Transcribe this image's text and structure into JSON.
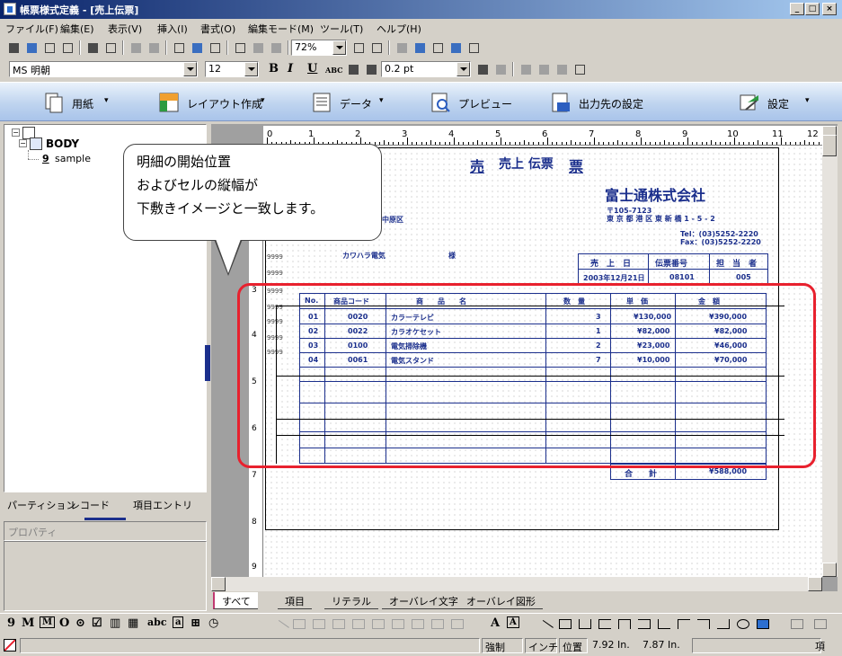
{
  "window": {
    "title": "帳票様式定義 - [売上伝票]",
    "buttons": [
      "_",
      "□",
      "×"
    ]
  },
  "menu": [
    "ファイル(F)",
    "編集(E)",
    "表示(V)",
    "挿入(I)",
    "書式(O)",
    "編集モード(M)",
    "ツール(T)",
    "ヘルプ(H)"
  ],
  "toolbar": {
    "zoom": "72%",
    "font_name": "MS 明朝",
    "font_size": "12",
    "bold": "B",
    "italic": "I",
    "underline": "U",
    "abc": "ABC",
    "line_width": "0.2 pt"
  },
  "ribbon": {
    "paper": "用紙",
    "layout": "レイアウト作成",
    "data": "データ",
    "preview": "プレビュー",
    "output": "出力先の設定",
    "settings": "設定"
  },
  "tree": {
    "root": "BODY",
    "child_num": "9",
    "child_label": "sample"
  },
  "left_tabs": {
    "partition": "パーティション",
    "record": "レコード",
    "item_entry": "項目エントリ"
  },
  "properties_label": "プロパティ",
  "sheet_tabs": [
    "すべて",
    "項目",
    "リテラル",
    "オーバレイ文字",
    "オーバレイ図形"
  ],
  "ruler": {
    "top": [
      "0",
      "1",
      "2",
      "3",
      "4",
      "5",
      "6",
      "7",
      "8",
      "9",
      "10",
      "11",
      "12"
    ],
    "left": [
      "3",
      "4",
      "5",
      "6",
      "7",
      "8",
      "9"
    ]
  },
  "callout": {
    "line1": "明細の開始位置",
    "line2": "およびセルの縦幅が",
    "line3": "下敷きイメージと一致します。"
  },
  "document": {
    "title_a": "売",
    "title_b": "売上 伝票",
    "title_c": "票",
    "company": "富士通株式会社",
    "postal": "〒105-7123",
    "address": "東 京 都 港 区 東 新 橋 1 - 5 - 2",
    "tel": "Tel：(03)5252-2220",
    "fax": "Fax：(03)5252-2220",
    "customer_area": "中原区",
    "customer_name": "カワハラ電気",
    "honorific": "様",
    "row_markers": [
      "9999",
      "9999",
      "9999",
      "9999",
      "9999",
      "9999",
      "9999"
    ],
    "info_headers": [
      "売　上　日",
      "伝票番号",
      "担　当　者"
    ],
    "info_values": [
      "2003年12月21日",
      "08101",
      "005"
    ],
    "table_headers": [
      "No.",
      "商品コード",
      "商　　品　　名",
      "数　量",
      "単　価",
      "金　額"
    ],
    "rows": [
      [
        "01",
        "0020",
        "カラーテレビ",
        "3",
        "¥130,000",
        "¥390,000"
      ],
      [
        "02",
        "0022",
        "カラオケセット",
        "1",
        "¥82,000",
        "¥82,000"
      ],
      [
        "03",
        "0100",
        "電気掃除機",
        "2",
        "¥23,000",
        "¥46,000"
      ],
      [
        "04",
        "0061",
        "電気スタンド",
        "7",
        "¥10,000",
        "¥70,000"
      ]
    ],
    "total_label": "合　　計",
    "total_value": "¥588,000"
  },
  "status": {
    "mode": "強制",
    "unit": "インチ",
    "pos_label": "位置",
    "x": "7.92 In.",
    "y": "7.87 In.",
    "item": "項"
  },
  "colors": {
    "doc_blue": "#1b2f8c",
    "highlight_red": "#e8212e",
    "ribbon_blue": "#bfd4ef"
  }
}
